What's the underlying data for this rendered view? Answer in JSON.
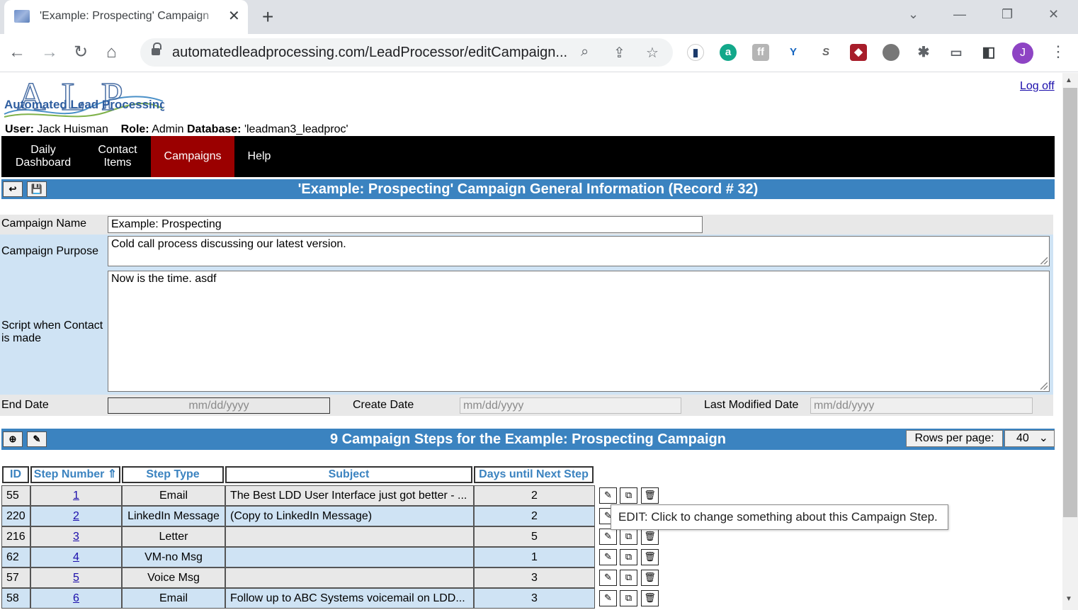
{
  "browser": {
    "tab_title": "'Example: Prospecting' Campaign",
    "url": "automatedleadprocessing.com/LeadProcessor/editCampaign...",
    "profile_initial": "J"
  },
  "app": {
    "logo_text": "Automated Lead Processing",
    "logo_letters": "ALP",
    "logout": "Log off",
    "user_label": "User:",
    "user_value": "Jack Huisman",
    "role_label": "Role:",
    "role_value": "Admin",
    "db_label": "Database:",
    "db_value": "'leadman3_leadproc'"
  },
  "menu": [
    {
      "label": "Daily Dashboard"
    },
    {
      "label": "Contact Items"
    },
    {
      "label": "Campaigns"
    },
    {
      "label": "Help"
    }
  ],
  "general": {
    "title": "'Example: Prospecting' Campaign General Information (Record # 32)",
    "name_label": "Campaign Name",
    "name_value": "Example: Prospecting",
    "purpose_label": "Campaign Purpose",
    "purpose_value": "Cold call process discussing our latest version.",
    "script_label": "Script when Contact is made",
    "script_value": "Now is the time. asdf",
    "end_date_label": "End Date",
    "create_date_label": "Create Date",
    "modified_date_label": "Last Modified Date",
    "date_placeholder": "mm/dd/yyyy"
  },
  "steps": {
    "title": "9 Campaign Steps for the Example: Prospecting Campaign",
    "rows_per_page_label": "Rows per page:",
    "rows_per_page_value": "40",
    "headers": [
      "ID",
      "Step Number ⇑",
      "Step Type",
      "Subject",
      "Days until Next Step"
    ],
    "rows": [
      {
        "id": "55",
        "step": "1",
        "type": "Email",
        "subject": "The Best LDD User Interface just got better - ...",
        "days": "2"
      },
      {
        "id": "220",
        "step": "2",
        "type": "LinkedIn Message",
        "subject": "(Copy to LinkedIn Message)",
        "days": "2"
      },
      {
        "id": "216",
        "step": "3",
        "type": "Letter",
        "subject": "",
        "days": "5"
      },
      {
        "id": "62",
        "step": "4",
        "type": "VM-no Msg",
        "subject": "",
        "days": "1"
      },
      {
        "id": "57",
        "step": "5",
        "type": "Voice Msg",
        "subject": "",
        "days": "3"
      },
      {
        "id": "58",
        "step": "6",
        "type": "Email",
        "subject": "Follow up to ABC Systems voicemail on LDD...",
        "days": "3"
      }
    ],
    "tooltip": "EDIT: Click to change something about this Campaign Step."
  },
  "colors": {
    "section_bar": "#3b83c0",
    "menu_bg": "#000000",
    "menu_active": "#9b0000",
    "row_blue": "#cfe3f4",
    "row_gray": "#e8e8e8"
  }
}
